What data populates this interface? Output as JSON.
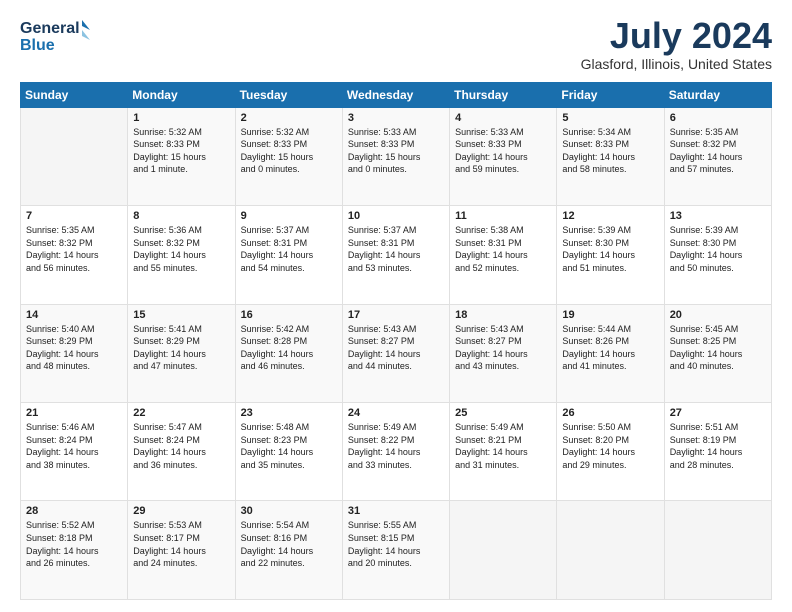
{
  "logo": {
    "line1": "General",
    "line2": "Blue"
  },
  "title": "July 2024",
  "location": "Glasford, Illinois, United States",
  "days_of_week": [
    "Sunday",
    "Monday",
    "Tuesday",
    "Wednesday",
    "Thursday",
    "Friday",
    "Saturday"
  ],
  "weeks": [
    [
      {
        "day": "",
        "info": ""
      },
      {
        "day": "1",
        "info": "Sunrise: 5:32 AM\nSunset: 8:33 PM\nDaylight: 15 hours\nand 1 minute."
      },
      {
        "day": "2",
        "info": "Sunrise: 5:32 AM\nSunset: 8:33 PM\nDaylight: 15 hours\nand 0 minutes."
      },
      {
        "day": "3",
        "info": "Sunrise: 5:33 AM\nSunset: 8:33 PM\nDaylight: 15 hours\nand 0 minutes."
      },
      {
        "day": "4",
        "info": "Sunrise: 5:33 AM\nSunset: 8:33 PM\nDaylight: 14 hours\nand 59 minutes."
      },
      {
        "day": "5",
        "info": "Sunrise: 5:34 AM\nSunset: 8:33 PM\nDaylight: 14 hours\nand 58 minutes."
      },
      {
        "day": "6",
        "info": "Sunrise: 5:35 AM\nSunset: 8:32 PM\nDaylight: 14 hours\nand 57 minutes."
      }
    ],
    [
      {
        "day": "7",
        "info": "Sunrise: 5:35 AM\nSunset: 8:32 PM\nDaylight: 14 hours\nand 56 minutes."
      },
      {
        "day": "8",
        "info": "Sunrise: 5:36 AM\nSunset: 8:32 PM\nDaylight: 14 hours\nand 55 minutes."
      },
      {
        "day": "9",
        "info": "Sunrise: 5:37 AM\nSunset: 8:31 PM\nDaylight: 14 hours\nand 54 minutes."
      },
      {
        "day": "10",
        "info": "Sunrise: 5:37 AM\nSunset: 8:31 PM\nDaylight: 14 hours\nand 53 minutes."
      },
      {
        "day": "11",
        "info": "Sunrise: 5:38 AM\nSunset: 8:31 PM\nDaylight: 14 hours\nand 52 minutes."
      },
      {
        "day": "12",
        "info": "Sunrise: 5:39 AM\nSunset: 8:30 PM\nDaylight: 14 hours\nand 51 minutes."
      },
      {
        "day": "13",
        "info": "Sunrise: 5:39 AM\nSunset: 8:30 PM\nDaylight: 14 hours\nand 50 minutes."
      }
    ],
    [
      {
        "day": "14",
        "info": "Sunrise: 5:40 AM\nSunset: 8:29 PM\nDaylight: 14 hours\nand 48 minutes."
      },
      {
        "day": "15",
        "info": "Sunrise: 5:41 AM\nSunset: 8:29 PM\nDaylight: 14 hours\nand 47 minutes."
      },
      {
        "day": "16",
        "info": "Sunrise: 5:42 AM\nSunset: 8:28 PM\nDaylight: 14 hours\nand 46 minutes."
      },
      {
        "day": "17",
        "info": "Sunrise: 5:43 AM\nSunset: 8:27 PM\nDaylight: 14 hours\nand 44 minutes."
      },
      {
        "day": "18",
        "info": "Sunrise: 5:43 AM\nSunset: 8:27 PM\nDaylight: 14 hours\nand 43 minutes."
      },
      {
        "day": "19",
        "info": "Sunrise: 5:44 AM\nSunset: 8:26 PM\nDaylight: 14 hours\nand 41 minutes."
      },
      {
        "day": "20",
        "info": "Sunrise: 5:45 AM\nSunset: 8:25 PM\nDaylight: 14 hours\nand 40 minutes."
      }
    ],
    [
      {
        "day": "21",
        "info": "Sunrise: 5:46 AM\nSunset: 8:24 PM\nDaylight: 14 hours\nand 38 minutes."
      },
      {
        "day": "22",
        "info": "Sunrise: 5:47 AM\nSunset: 8:24 PM\nDaylight: 14 hours\nand 36 minutes."
      },
      {
        "day": "23",
        "info": "Sunrise: 5:48 AM\nSunset: 8:23 PM\nDaylight: 14 hours\nand 35 minutes."
      },
      {
        "day": "24",
        "info": "Sunrise: 5:49 AM\nSunset: 8:22 PM\nDaylight: 14 hours\nand 33 minutes."
      },
      {
        "day": "25",
        "info": "Sunrise: 5:49 AM\nSunset: 8:21 PM\nDaylight: 14 hours\nand 31 minutes."
      },
      {
        "day": "26",
        "info": "Sunrise: 5:50 AM\nSunset: 8:20 PM\nDaylight: 14 hours\nand 29 minutes."
      },
      {
        "day": "27",
        "info": "Sunrise: 5:51 AM\nSunset: 8:19 PM\nDaylight: 14 hours\nand 28 minutes."
      }
    ],
    [
      {
        "day": "28",
        "info": "Sunrise: 5:52 AM\nSunset: 8:18 PM\nDaylight: 14 hours\nand 26 minutes."
      },
      {
        "day": "29",
        "info": "Sunrise: 5:53 AM\nSunset: 8:17 PM\nDaylight: 14 hours\nand 24 minutes."
      },
      {
        "day": "30",
        "info": "Sunrise: 5:54 AM\nSunset: 8:16 PM\nDaylight: 14 hours\nand 22 minutes."
      },
      {
        "day": "31",
        "info": "Sunrise: 5:55 AM\nSunset: 8:15 PM\nDaylight: 14 hours\nand 20 minutes."
      },
      {
        "day": "",
        "info": ""
      },
      {
        "day": "",
        "info": ""
      },
      {
        "day": "",
        "info": ""
      }
    ]
  ]
}
